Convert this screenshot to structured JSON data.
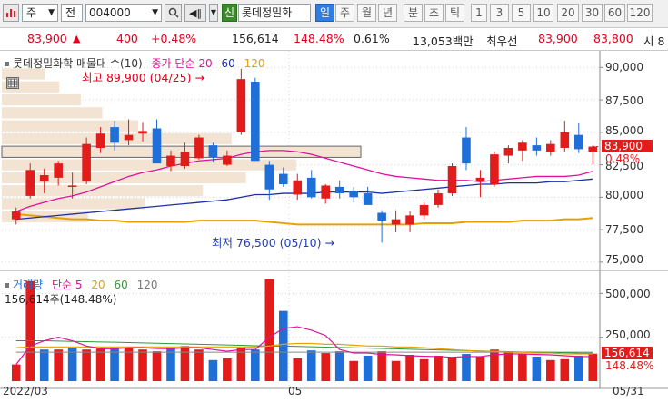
{
  "toolbar": {
    "type_select": "주",
    "prefix_select": "전",
    "stock_code": "004000",
    "credit_badge": "신",
    "stock_name": "롯데정밀화",
    "period_labels": [
      "일",
      "주",
      "월",
      "년",
      "분",
      "초",
      "틱"
    ],
    "active_period": "일",
    "minute_options": [
      "1",
      "3",
      "5",
      "10",
      "20",
      "30",
      "60",
      "120"
    ]
  },
  "quote": {
    "price": "83,900",
    "change": "400",
    "change_pct": "+0.48%",
    "volume": "156,614",
    "volume_ratio": "148.48%",
    "turnover": "0.61%",
    "amount": "13,053백만",
    "best_ask_label": "최우선",
    "best_ask": "83,900",
    "best_bid": "83,800",
    "next_label": "시 8"
  },
  "price_panel": {
    "legend_name": "롯데정밀화학 매물대 수(10)",
    "legend_close": "종가",
    "legend_ma_type": "단순",
    "ma_periods": [
      "20",
      "60",
      "120"
    ],
    "high_label": "최고 89,900 (04/25)",
    "low_label": "최저 76,500 (05/10)",
    "y_ticks": [
      "90,000",
      "87,500",
      "85,000",
      "82,500",
      "80,000",
      "77,500",
      "75,000"
    ],
    "current_price_tag": "83,900",
    "current_pct_tag": "0.48%"
  },
  "volume_panel": {
    "legend_label": "거래량",
    "legend_ma_type": "단순",
    "ma_periods": [
      "5",
      "20",
      "60",
      "120"
    ],
    "sub_label": "156,614주(148.48%)",
    "y_ticks": [
      "500,000",
      "250,000"
    ],
    "current_volume_tag": "156,614",
    "current_pct_tag": "148.48%"
  },
  "x_axis": {
    "labels": [
      "2022/03",
      "05",
      "05/31"
    ]
  },
  "colors": {
    "up": "#e21b1b",
    "down": "#1f6fd6",
    "ma20": "#e0119a",
    "ma60": "#1c2fa8",
    "ma120": "#e6a100"
  },
  "chart_data": {
    "type": "candlestick",
    "candles": [
      {
        "o": 78.3,
        "h": 79.2,
        "l": 77.9,
        "c": 78.9
      },
      {
        "o": 80.1,
        "h": 82.6,
        "l": 79.9,
        "c": 82.1
      },
      {
        "o": 81.2,
        "h": 82.2,
        "l": 80.3,
        "c": 81.7
      },
      {
        "o": 81.5,
        "h": 82.8,
        "l": 80.9,
        "c": 82.6
      },
      {
        "o": 80.8,
        "h": 81.9,
        "l": 79.9,
        "c": 80.9
      },
      {
        "o": 81.2,
        "h": 84.6,
        "l": 81.0,
        "c": 84.1
      },
      {
        "o": 83.8,
        "h": 85.4,
        "l": 83.4,
        "c": 84.9
      },
      {
        "o": 85.4,
        "h": 85.9,
        "l": 83.6,
        "c": 84.2
      },
      {
        "o": 84.4,
        "h": 86.0,
        "l": 84.0,
        "c": 84.8
      },
      {
        "o": 84.9,
        "h": 85.8,
        "l": 84.3,
        "c": 85.1
      },
      {
        "o": 85.3,
        "h": 86.0,
        "l": 82.8,
        "c": 82.6
      },
      {
        "o": 82.4,
        "h": 83.6,
        "l": 82.0,
        "c": 83.2
      },
      {
        "o": 82.4,
        "h": 84.2,
        "l": 82.2,
        "c": 83.5
      },
      {
        "o": 83.0,
        "h": 84.8,
        "l": 82.9,
        "c": 84.6
      },
      {
        "o": 84.0,
        "h": 84.2,
        "l": 82.7,
        "c": 83.1
      },
      {
        "o": 82.5,
        "h": 83.6,
        "l": 82.4,
        "c": 83.2
      },
      {
        "o": 85.0,
        "h": 89.9,
        "l": 84.8,
        "c": 89.1
      },
      {
        "o": 88.9,
        "h": 89.2,
        "l": 82.8,
        "c": 82.8
      },
      {
        "o": 82.5,
        "h": 82.8,
        "l": 79.8,
        "c": 80.6
      },
      {
        "o": 81.8,
        "h": 82.3,
        "l": 80.8,
        "c": 81.0
      },
      {
        "o": 80.2,
        "h": 81.8,
        "l": 79.8,
        "c": 81.3
      },
      {
        "o": 81.5,
        "h": 82.1,
        "l": 79.9,
        "c": 80.0
      },
      {
        "o": 79.9,
        "h": 81.0,
        "l": 79.5,
        "c": 80.9
      },
      {
        "o": 80.8,
        "h": 81.3,
        "l": 79.9,
        "c": 80.3
      },
      {
        "o": 80.5,
        "h": 80.8,
        "l": 79.6,
        "c": 80.0
      },
      {
        "o": 80.3,
        "h": 80.8,
        "l": 79.5,
        "c": 79.4
      },
      {
        "o": 78.8,
        "h": 79.0,
        "l": 76.5,
        "c": 78.2
      },
      {
        "o": 77.9,
        "h": 79.0,
        "l": 77.3,
        "c": 78.3
      },
      {
        "o": 77.9,
        "h": 78.9,
        "l": 77.3,
        "c": 78.6
      },
      {
        "o": 78.6,
        "h": 79.6,
        "l": 78.3,
        "c": 79.4
      },
      {
        "o": 79.4,
        "h": 80.6,
        "l": 79.2,
        "c": 80.3
      },
      {
        "o": 80.3,
        "h": 82.6,
        "l": 80.1,
        "c": 82.4
      },
      {
        "o": 84.6,
        "h": 85.4,
        "l": 82.1,
        "c": 82.6
      },
      {
        "o": 81.2,
        "h": 82.1,
        "l": 80.0,
        "c": 81.5
      },
      {
        "o": 81.0,
        "h": 83.5,
        "l": 80.8,
        "c": 83.3
      },
      {
        "o": 83.2,
        "h": 84.0,
        "l": 82.6,
        "c": 83.8
      },
      {
        "o": 83.6,
        "h": 84.4,
        "l": 82.8,
        "c": 84.2
      },
      {
        "o": 84.0,
        "h": 84.6,
        "l": 83.2,
        "c": 83.6
      },
      {
        "o": 83.5,
        "h": 84.4,
        "l": 83.2,
        "c": 84.1
      },
      {
        "o": 83.8,
        "h": 85.9,
        "l": 83.5,
        "c": 85.0
      },
      {
        "o": 84.8,
        "h": 85.7,
        "l": 83.4,
        "c": 83.7
      },
      {
        "o": 83.5,
        "h": 84.0,
        "l": 82.5,
        "c": 83.9
      }
    ],
    "ma20": [
      78.9,
      79.3,
      79.6,
      79.9,
      80.1,
      80.4,
      80.8,
      81.2,
      81.6,
      81.9,
      82.1,
      82.4,
      82.6,
      82.8,
      82.9,
      83.0,
      83.3,
      83.5,
      83.6,
      83.6,
      83.5,
      83.3,
      83.0,
      82.7,
      82.4,
      82.1,
      81.8,
      81.6,
      81.5,
      81.4,
      81.3,
      81.3,
      81.3,
      81.2,
      81.3,
      81.4,
      81.5,
      81.6,
      81.6,
      81.6,
      81.7,
      82.0
    ],
    "ma60": [
      78.3,
      78.4,
      78.5,
      78.6,
      78.7,
      78.8,
      78.9,
      79.0,
      79.1,
      79.2,
      79.3,
      79.4,
      79.5,
      79.6,
      79.7,
      79.8,
      80.0,
      80.2,
      80.2,
      80.3,
      80.3,
      80.3,
      80.4,
      80.4,
      80.4,
      80.4,
      80.3,
      80.4,
      80.5,
      80.6,
      80.7,
      80.8,
      80.9,
      81.0,
      81.0,
      81.1,
      81.1,
      81.1,
      81.2,
      81.2,
      81.3,
      81.4
    ],
    "ma120": [
      78.7,
      78.6,
      78.5,
      78.4,
      78.3,
      78.3,
      78.2,
      78.2,
      78.1,
      78.1,
      78.1,
      78.1,
      78.1,
      78.2,
      78.2,
      78.2,
      78.2,
      78.2,
      78.1,
      78.0,
      77.9,
      77.9,
      77.9,
      77.9,
      77.9,
      77.9,
      77.9,
      77.9,
      77.9,
      78.0,
      78.0,
      78.0,
      78.1,
      78.1,
      78.1,
      78.1,
      78.2,
      78.2,
      78.2,
      78.3,
      78.3,
      78.4
    ],
    "volume_profile": [
      {
        "y_low": 89.0,
        "y_high": 90.0,
        "value": 30
      },
      {
        "y_low": 88.0,
        "y_high": 89.0,
        "value": 40
      },
      {
        "y_low": 87.0,
        "y_high": 88.0,
        "value": 55
      },
      {
        "y_low": 86.0,
        "y_high": 87.0,
        "value": 70
      },
      {
        "y_low": 85.0,
        "y_high": 86.0,
        "value": 95
      },
      {
        "y_low": 84.0,
        "y_high": 85.0,
        "value": 160
      },
      {
        "y_low": 83.0,
        "y_high": 84.0,
        "value": 250
      },
      {
        "y_low": 82.0,
        "y_high": 83.0,
        "value": 205
      },
      {
        "y_low": 81.0,
        "y_high": 82.0,
        "value": 170
      },
      {
        "y_low": 80.0,
        "y_high": 81.0,
        "value": 140
      },
      {
        "y_low": 79.0,
        "y_high": 80.0,
        "value": 100
      },
      {
        "y_low": 78.0,
        "y_high": 79.0,
        "value": 60
      }
    ],
    "volume": [
      95,
      570,
      180,
      180,
      190,
      180,
      185,
      190,
      190,
      180,
      170,
      190,
      200,
      180,
      120,
      130,
      190,
      180,
      580,
      400,
      130,
      175,
      160,
      170,
      115,
      145,
      170,
      115,
      150,
      125,
      145,
      135,
      155,
      140,
      180,
      165,
      155,
      140,
      120,
      125,
      145,
      156.6
    ],
    "volume_up": [
      1,
      1,
      0,
      1,
      0,
      1,
      1,
      0,
      1,
      1,
      1,
      0,
      1,
      1,
      0,
      1,
      1,
      0,
      1,
      0,
      1,
      0,
      1,
      0,
      1,
      0,
      1,
      1,
      1,
      1,
      1,
      1,
      0,
      1,
      1,
      1,
      1,
      0,
      1,
      1,
      0,
      1
    ],
    "volume_ma5": [
      95,
      200,
      230,
      250,
      230,
      200,
      185,
      185,
      190,
      190,
      186,
      185,
      190,
      190,
      180,
      170,
      180,
      180,
      250,
      300,
      310,
      290,
      260,
      180,
      160,
      160,
      152,
      150,
      145,
      142,
      140,
      136,
      140,
      140,
      150,
      155,
      155,
      152,
      150,
      145,
      140,
      140
    ],
    "volume_ma20": [
      190,
      195,
      195,
      195,
      195,
      195,
      195,
      195,
      195,
      195,
      195,
      195,
      195,
      195,
      195,
      195,
      195,
      195,
      200,
      210,
      215,
      215,
      210,
      210,
      205,
      200,
      200,
      195,
      195,
      190,
      185,
      180,
      175,
      170,
      170,
      165,
      165,
      160,
      160,
      155,
      155,
      155
    ],
    "volume_ma60": [
      230,
      230,
      230,
      228,
      226,
      225,
      223,
      222,
      220,
      218,
      216,
      214,
      212,
      210,
      208,
      206,
      204,
      202,
      200,
      200,
      198,
      196,
      194,
      192,
      190,
      188,
      186,
      184,
      182,
      180,
      178,
      176,
      174,
      172,
      170,
      168,
      166,
      165,
      164,
      162,
      160,
      160
    ],
    "volume_ma120": [
      165,
      165,
      165,
      165,
      165,
      165,
      165,
      165,
      165,
      165,
      165,
      165,
      165,
      165,
      165,
      165,
      165,
      165,
      165,
      165,
      165,
      165,
      165,
      165,
      165,
      165,
      165,
      165,
      165,
      165,
      165,
      165,
      165,
      165,
      165,
      165,
      165,
      165,
      165,
      165,
      165,
      165
    ],
    "price_range": [
      74.5,
      91.0
    ],
    "volume_range": [
      0,
      600
    ]
  }
}
